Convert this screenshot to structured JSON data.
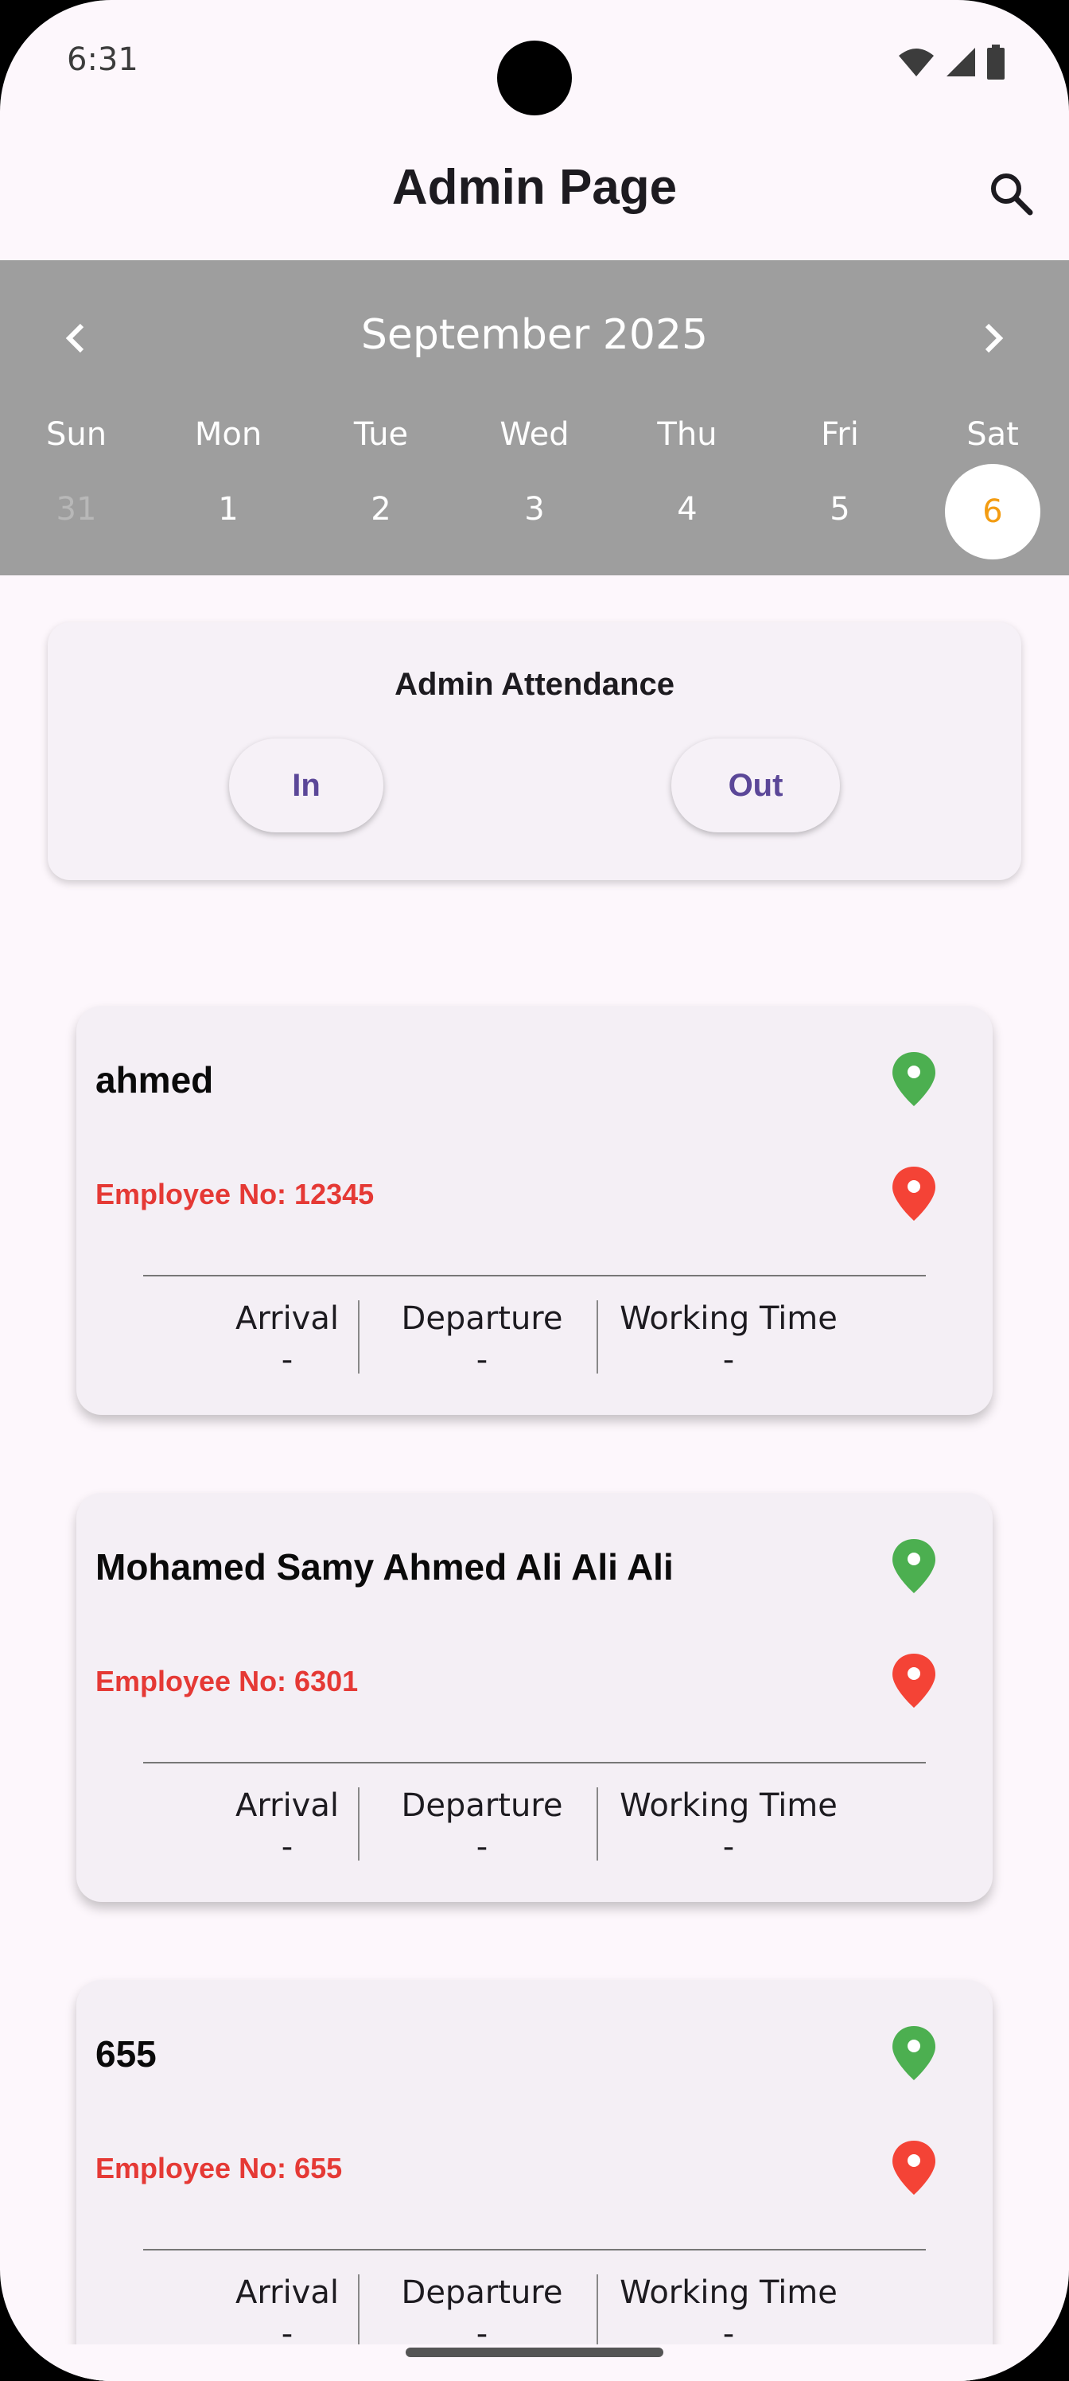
{
  "status_bar": {
    "time": "6:31",
    "icons": [
      "wifi-icon",
      "signal-icon",
      "battery-icon"
    ]
  },
  "app_bar": {
    "title": "Admin Page",
    "search_icon": "search-icon"
  },
  "calendar": {
    "month_label": "September 2025",
    "weekdays": [
      "Sun",
      "Mon",
      "Tue",
      "Wed",
      "Thu",
      "Fri",
      "Sat"
    ],
    "dates": [
      "31",
      "1",
      "2",
      "3",
      "4",
      "5",
      "6"
    ],
    "selected_date": "6",
    "colors": {
      "background": "#9e9e9e",
      "selected_text": "#f39c12"
    }
  },
  "admin_attendance": {
    "title": "Admin Attendance",
    "in_label": "In",
    "out_label": "Out"
  },
  "employees": [
    {
      "name": "ahmed",
      "employee_no": "Employee No: 12345",
      "arrival_label": "Arrival",
      "arrival_value": "-",
      "departure_label": "Departure",
      "departure_value": "-",
      "working_label": "Working Time",
      "working_value": "-"
    },
    {
      "name": "Mohamed Samy Ahmed Ali Ali Ali",
      "employee_no": "Employee No: 6301",
      "arrival_label": "Arrival",
      "arrival_value": "-",
      "departure_label": "Departure",
      "departure_value": "-",
      "working_label": "Working Time",
      "working_value": "-"
    },
    {
      "name": "655",
      "employee_no": "Employee No: 655",
      "arrival_label": "Arrival",
      "arrival_value": "-",
      "departure_label": "Departure",
      "departure_value": "-",
      "working_label": "Working Time",
      "working_value": "-"
    }
  ],
  "colors": {
    "pin_green": "#4caf50",
    "pin_red": "#f44336",
    "employee_no": "#e53935",
    "accent": "#5b4798"
  }
}
